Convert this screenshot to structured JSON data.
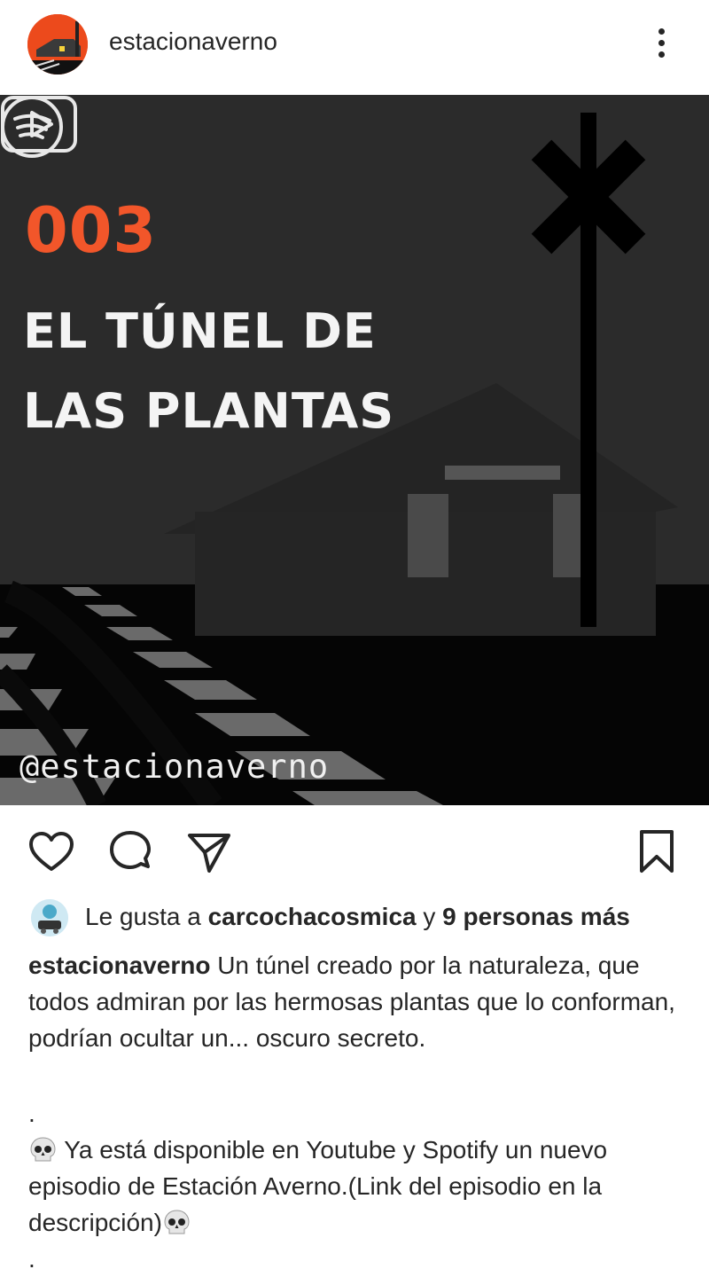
{
  "header": {
    "username": "estacionaverno",
    "avatar_icon": "station-logo-icon",
    "more_icon": "more-vertical-icon"
  },
  "post_image": {
    "episode_number": "003",
    "title": "EL TÚNEL DE LAS PLANTAS",
    "handle": "@estacionaverno",
    "icons": [
      "youtube-icon",
      "spotify-icon"
    ]
  },
  "actions": {
    "icons": [
      "heart-icon",
      "comment-icon",
      "share-icon",
      "bookmark-icon"
    ]
  },
  "likes": {
    "prefix": "Le gusta a",
    "user": "carcochacosmica",
    "conjunction": "y",
    "others": "9 personas más"
  },
  "caption": {
    "username": "estacionaverno",
    "text": "Un túnel creado por la naturaleza, que todos admiran por las hermosas plantas que lo conforman, podrían ocultar un... oscuro secreto.",
    "dot1": ".",
    "line2": "Ya está disponible en Youtube y Spotify un nuevo episodio de Estación Averno.(Link del episodio en la descripción)",
    "dot2": "."
  },
  "colors": {
    "accent_orange": "#f2562a",
    "image_background": "#2b2b2b",
    "text": "#262626"
  }
}
